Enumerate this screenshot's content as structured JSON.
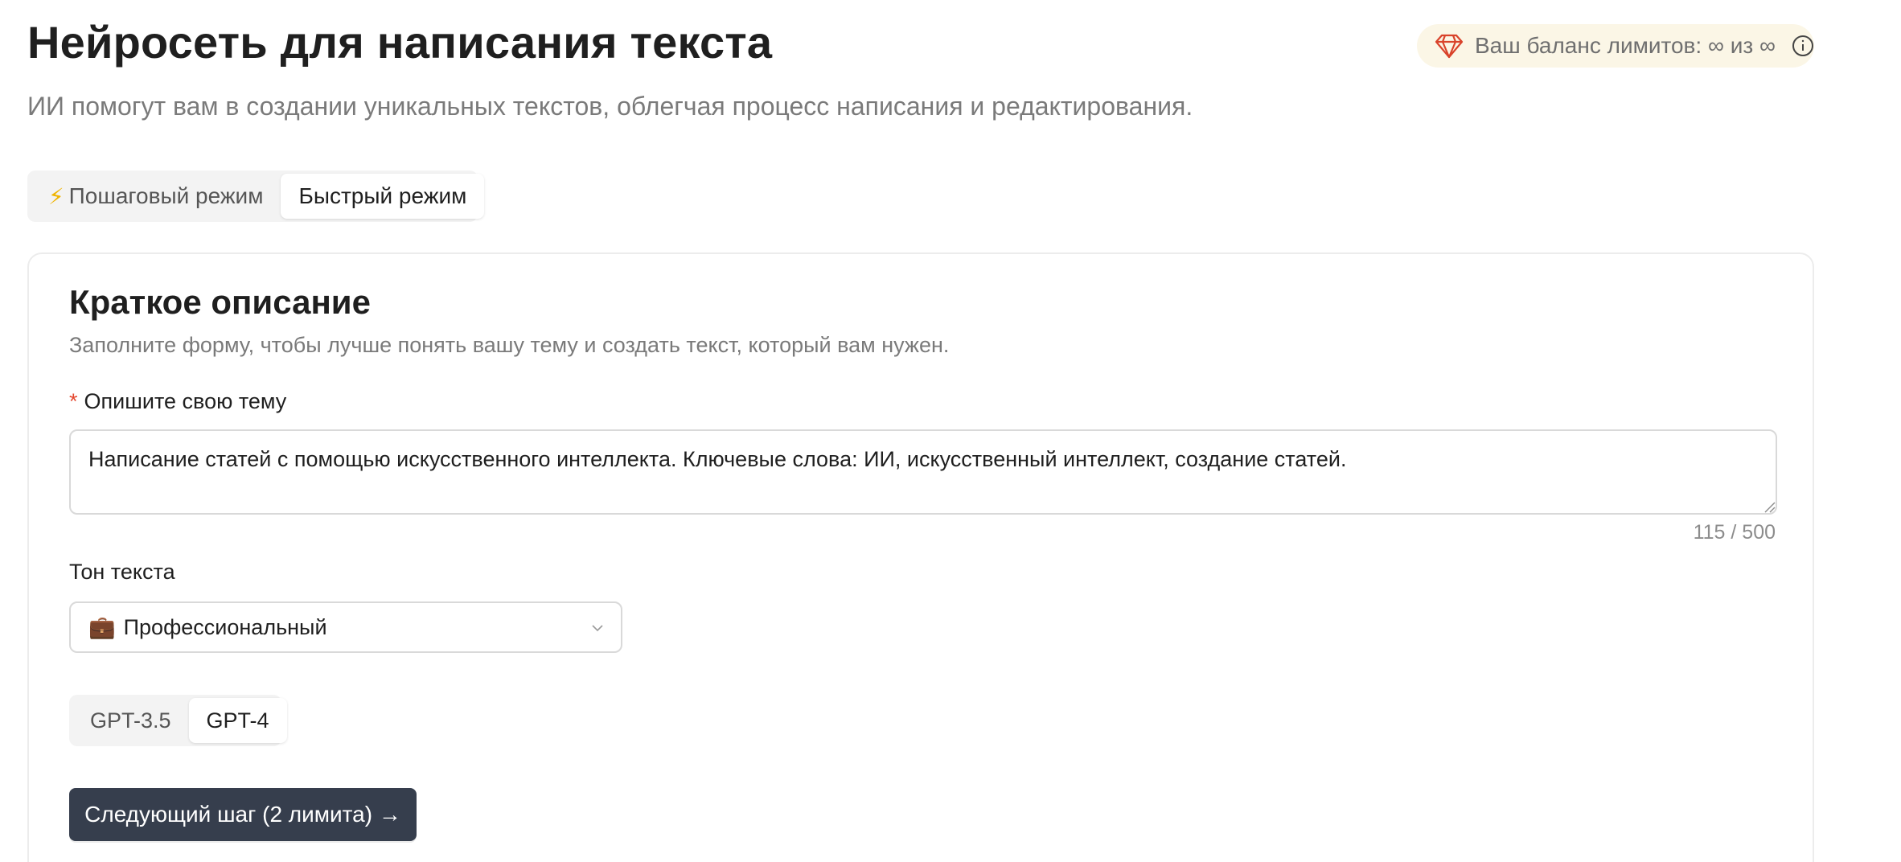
{
  "header": {
    "title": "Нейросеть для написания текста",
    "subtitle": "ИИ помогут вам в создании уникальных текстов, облегчая процесс написания и редактирования."
  },
  "balance": {
    "text": "Ваш баланс лимитов: ∞ из ∞",
    "icon": "gem-icon",
    "info_icon": "info-icon",
    "gem_color": "#d9432b"
  },
  "modes": {
    "items": [
      {
        "label": "Пошаговый режим",
        "icon": "bolt-icon",
        "active": false
      },
      {
        "label": "Быстрый режим",
        "active": true
      }
    ]
  },
  "form": {
    "title": "Краткое описание",
    "description": "Заполните форму, чтобы лучше понять вашу тему и создать текст, который вам нужен.",
    "topic": {
      "required_mark": "*",
      "label": "Опишите свою тему",
      "value": "Написание статей с помощью искусственного интеллекта. Ключевые слова: ИИ, искусственный интеллект, создание статей.",
      "counter": "115 / 500"
    },
    "tone": {
      "label": "Тон текста",
      "selected_icon": "💼",
      "selected": "Профессиональный"
    },
    "models": {
      "items": [
        {
          "label": "GPT-3.5",
          "active": false
        },
        {
          "label": "GPT-4",
          "active": true
        }
      ]
    },
    "next_button": "Следующий шаг (2 лимита) →"
  },
  "colors": {
    "button_bg": "#363e4d",
    "balance_bg": "#fbf6e6",
    "required": "#e4472f",
    "bolt": "#f0b400"
  }
}
